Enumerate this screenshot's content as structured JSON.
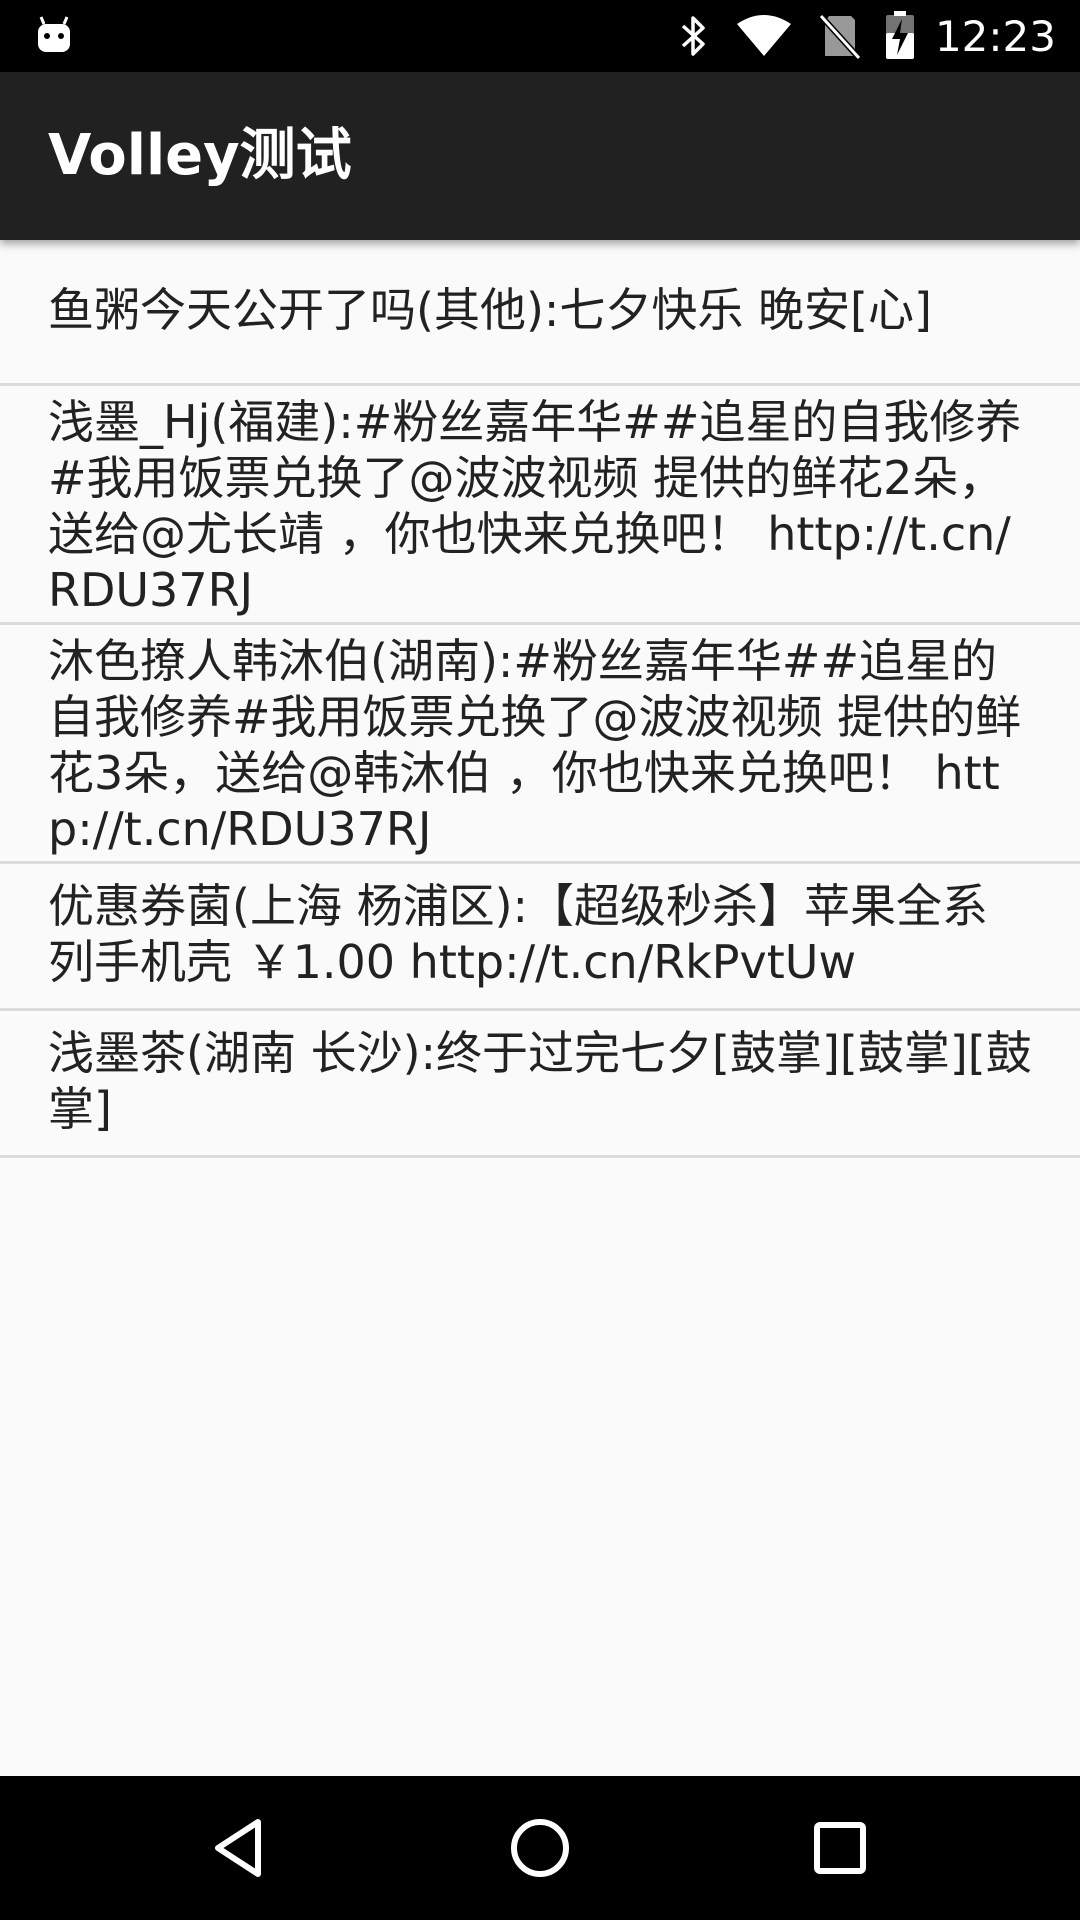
{
  "status_bar": {
    "time": "12:23",
    "icons": [
      "android-icon",
      "bluetooth-icon",
      "wifi-icon",
      "no-sim-icon",
      "battery-charging-icon"
    ]
  },
  "app_bar": {
    "title": "Volley测试"
  },
  "list": {
    "items": [
      {
        "text": "鱼粥今天公开了吗(其他):七夕快乐 晚安[心]"
      },
      {
        "text": "浅墨_Hj(福建):#粉丝嘉年华##追星的自我修养#我用饭票兑换了@波波视频 提供的鲜花2朵，送给@尤长靖 ，你也快来兑换吧！ http://t.cn/RDU37RJ"
      },
      {
        "text": "沐色撩人韩沐伯(湖南):#粉丝嘉年华##追星的自我修养#我用饭票兑换了@波波视频 提供的鲜花3朵，送给@韩沐伯 ，你也快来兑换吧！ http://t.cn/RDU37RJ"
      },
      {
        "text": "优惠券菌(上海 杨浦区):【超级秒杀】苹果全系列手机壳 ￥1.00 http://t.cn/RkPvtUw"
      },
      {
        "text": "浅墨茶(湖南 长沙):终于过完七夕[鼓掌][鼓掌][鼓掌]"
      }
    ]
  },
  "nav_bar": {
    "buttons": [
      "back-icon",
      "home-icon",
      "recents-icon"
    ]
  },
  "colors": {
    "status_bar": "#000000",
    "app_bar": "#212121",
    "background": "#fafafa",
    "divider": "#dcdcdc",
    "text": "#222222"
  }
}
